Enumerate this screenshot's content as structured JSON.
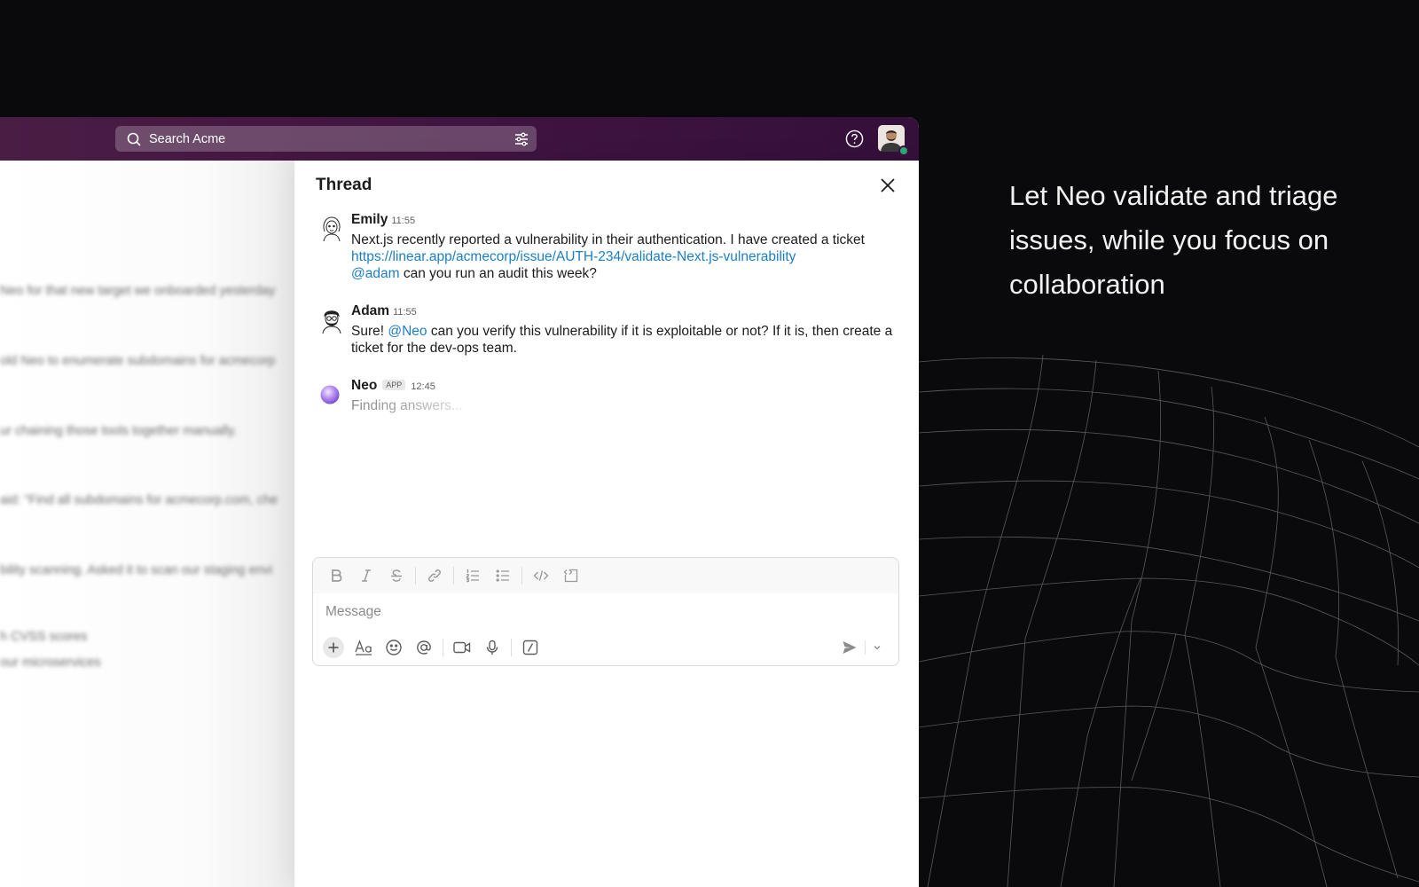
{
  "search": {
    "placeholder": "Search Acme"
  },
  "channel_blurred": {
    "lines": [
      "Neo for that new target we onboarded yesterday",
      "old Neo to enumerate subdomains for acmecorp",
      "ur chaining those tools together manually.",
      "aid: \"Find all subdomains for acmecorp.com, che",
      "bility scanning. Asked it to scan our staging envi",
      "h CVSS scores",
      "our microservices"
    ]
  },
  "thread": {
    "title": "Thread",
    "messages": [
      {
        "name": "Emily",
        "time": "11:55",
        "text1": "Next.js recently reported a vulnerability in their authentication. I have created a ticket",
        "link": "https://linear.app/acmecorp/issue/AUTH-234/validate-Next.js-vulnerability",
        "mention": "@adam",
        "text2": " can you run an audit this week?"
      },
      {
        "name": "Adam",
        "time": "11:55",
        "pre": "Sure! ",
        "mention": "@Neo",
        "text": " can you verify this vulnerability if it is exploitable or not? If it is, then create a ticket for the dev-ops team."
      },
      {
        "name": "Neo",
        "badge": "APP",
        "time": "12:45",
        "text": "Finding answers..."
      }
    ]
  },
  "composer": {
    "placeholder": "Message"
  },
  "promo": {
    "text": "Let Neo validate and triage issues, while you focus on collaboration"
  },
  "colors": {
    "topbar": "#3f1340",
    "link": "#1d7fc4",
    "presence": "#2bac76"
  }
}
